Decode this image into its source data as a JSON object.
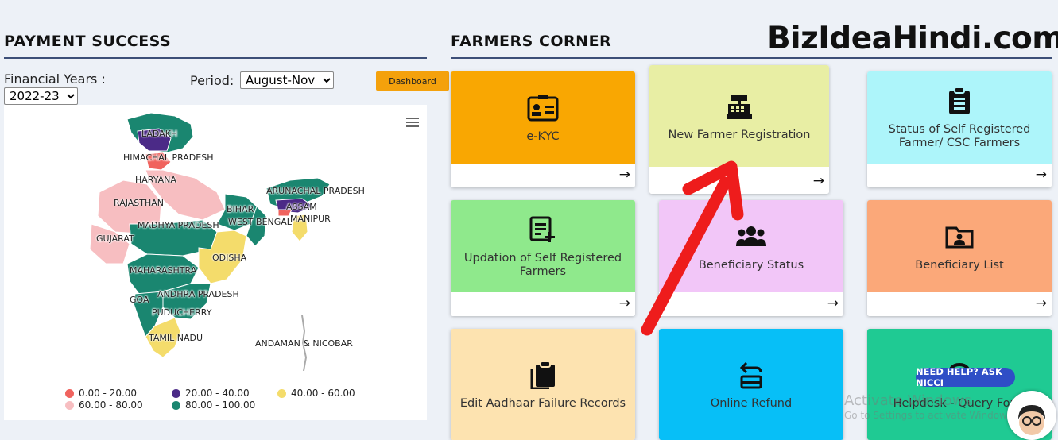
{
  "payment": {
    "title": "PAYMENT SUCCESS",
    "fy_label": "Financial Years :",
    "fy_value": "2022-23",
    "period_label": "Period:",
    "period_value": "August-Nov",
    "dashboard_label": "Dashboard"
  },
  "map": {
    "labels": {
      "ladakh": "LADAKH",
      "himachal": "HIMACHAL PRADESH",
      "haryana": "HARYANA",
      "rajasthan": "RAJASTHAN",
      "arunachal": "ARUNACHAL PRADESH",
      "bihar": "BIHAR",
      "assam": "ASSAM",
      "west_bengal": "WEST BENGAL",
      "manipur": "MANIPUR",
      "madhya": "MADHYA PRADESH",
      "gujarat": "GUJARAT",
      "odisha": "ODISHA",
      "maharashtra": "MAHARASHTRA",
      "goa": "GOA",
      "andhra": "ANDHRA PRADESH",
      "puducherry": "PUDUCHERRY",
      "tamil_nadu": "TAMIL NADU",
      "andaman": "ANDAMAN & NICOBAR"
    },
    "legend": [
      {
        "label": "0.00 - 20.00",
        "color": "#f0635e"
      },
      {
        "label": "20.00 - 40.00",
        "color": "#4b2a87"
      },
      {
        "label": "40.00 - 60.00",
        "color": "#f4dc6b"
      },
      {
        "label": "60.00 - 80.00",
        "color": "#f7bec1"
      },
      {
        "label": "80.00 - 100.00",
        "color": "#1a8670"
      }
    ]
  },
  "farmers": {
    "title": "FARMERS CORNER",
    "brand": "BizIdeaHindi.com",
    "cards": [
      {
        "label": "e-KYC",
        "icon": "id-card-icon",
        "color": "#f9a702"
      },
      {
        "label": "New Farmer Registration",
        "icon": "cash-register-icon",
        "color": "#e8eea4"
      },
      {
        "label": "Status of Self Registered Farmer/ CSC Farmers",
        "icon": "clipboard-icon",
        "color": "#adf5fa"
      },
      {
        "label": "Updation of Self Registered Farmers",
        "icon": "edit-list-icon",
        "color": "#8fe98c"
      },
      {
        "label": "Beneficiary Status",
        "icon": "users-icon",
        "color": "#f2c6f8"
      },
      {
        "label": "Beneficiary List",
        "icon": "folder-user-icon",
        "color": "#fba879"
      },
      {
        "label": "Edit Aadhaar Failure Records",
        "icon": "clipboard-copy-icon",
        "color": "#fde3b0"
      },
      {
        "label": "Online Refund",
        "icon": "refund-tray-icon",
        "color": "#07bff7"
      },
      {
        "label": "Helpdesk - Query Form",
        "icon": "headset-icon",
        "color": "#1fca93"
      }
    ]
  },
  "overlay": {
    "help": "NEED HELP? ASK NICCI",
    "watermark": "Activate Windows",
    "watermark2": "Go to Settings to activate Windows."
  }
}
